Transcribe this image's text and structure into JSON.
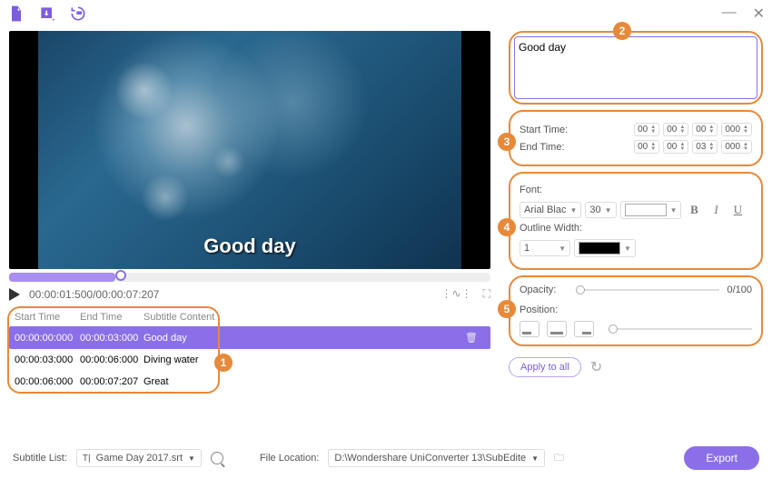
{
  "window": {
    "minimize": "—",
    "close": "✕"
  },
  "video": {
    "subtitle_overlay": "Good day"
  },
  "playback": {
    "time_display": "00:00:01:500/00:00:07:207"
  },
  "table": {
    "headers": {
      "start": "Start Time",
      "end": "End Time",
      "content": "Subtitle Content"
    },
    "rows": [
      {
        "start": "00:00:00:000",
        "end": "00:00:03:000",
        "content": "Good day"
      },
      {
        "start": "00:00:03:000",
        "end": "00:00:06:000",
        "content": "Diving water"
      },
      {
        "start": "00:00:06:000",
        "end": "00:00:07:207",
        "content": "Great"
      }
    ]
  },
  "editor": {
    "text_value": "Good day",
    "start_label": "Start Time:",
    "end_label": "End Time:",
    "start": {
      "h": "00",
      "m": "00",
      "s": "00",
      "ms": "000"
    },
    "end": {
      "h": "00",
      "m": "00",
      "s": "03",
      "ms": "000"
    },
    "font_label": "Font:",
    "font_family": "Arial Blac",
    "font_size": "30",
    "outline_label": "Outline Width:",
    "outline_width": "1",
    "opacity_label": "Opacity:",
    "opacity_value": "0/100",
    "position_label": "Position:",
    "apply_all": "Apply to all"
  },
  "footer": {
    "subtitle_list_label": "Subtitle List:",
    "subtitle_file": "Game Day 2017.srt",
    "file_loc_label": "File Location:",
    "file_loc": "D:\\Wondershare UniConverter 13\\SubEdite",
    "export": "Export"
  },
  "badges": {
    "b1": "1",
    "b2": "2",
    "b3": "3",
    "b4": "4",
    "b5": "5"
  }
}
